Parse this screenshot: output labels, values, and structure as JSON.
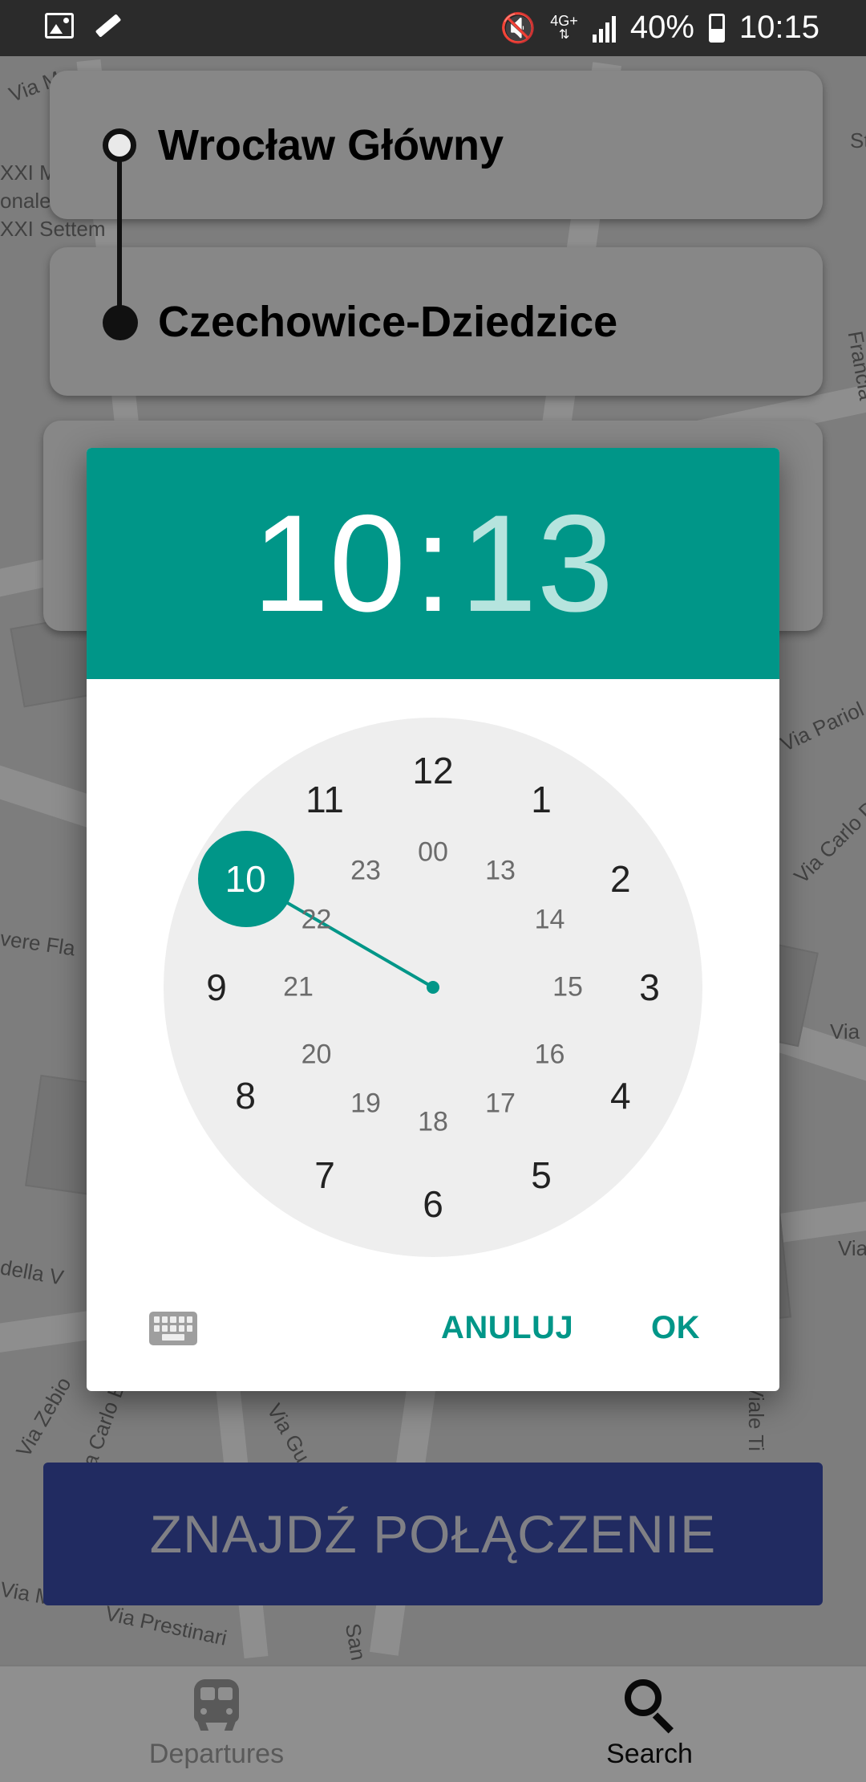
{
  "status_bar": {
    "network_top": "4G+",
    "battery": "40%",
    "time": "10:15"
  },
  "route": {
    "from": "Wrocław Główny",
    "to": "Czechowice-Dziedzice"
  },
  "map_labels": [
    "Via Ma",
    "XXI M",
    "onale",
    "XXI Settem",
    "Storio",
    "Francia",
    "Via Pariol",
    "Via Carlo Dolci",
    "vere Fla",
    "Via Se",
    "Via Ja",
    "della V",
    "Via Zebio",
    "Via Carlo E",
    "Via Gu",
    "Via Prestinari",
    "Via M",
    "San",
    "Viale Ti"
  ],
  "dialog": {
    "header_hours": "10",
    "header_colon": ":",
    "header_minutes": "13",
    "selected_value": "10",
    "outer_numbers": [
      "12",
      "1",
      "2",
      "3",
      "4",
      "5",
      "6",
      "7",
      "8",
      "9",
      "10",
      "11"
    ],
    "inner_numbers": [
      "00",
      "13",
      "14",
      "15",
      "16",
      "17",
      "18",
      "19",
      "20",
      "21",
      "22",
      "23"
    ],
    "cancel_label": "ANULUJ",
    "ok_label": "OK",
    "keyboard_icon": "keyboard-icon"
  },
  "find_button_label": "ZNAJDŹ POŁĄCZENIE",
  "bottom_nav": {
    "items": [
      {
        "label": "Departures",
        "icon": "train-icon",
        "active": false
      },
      {
        "label": "Search",
        "icon": "search-icon",
        "active": true
      }
    ]
  },
  "colors": {
    "accent": "#009688",
    "accent_light": "#b6e4de",
    "button_primary": "#3a4aa8"
  }
}
